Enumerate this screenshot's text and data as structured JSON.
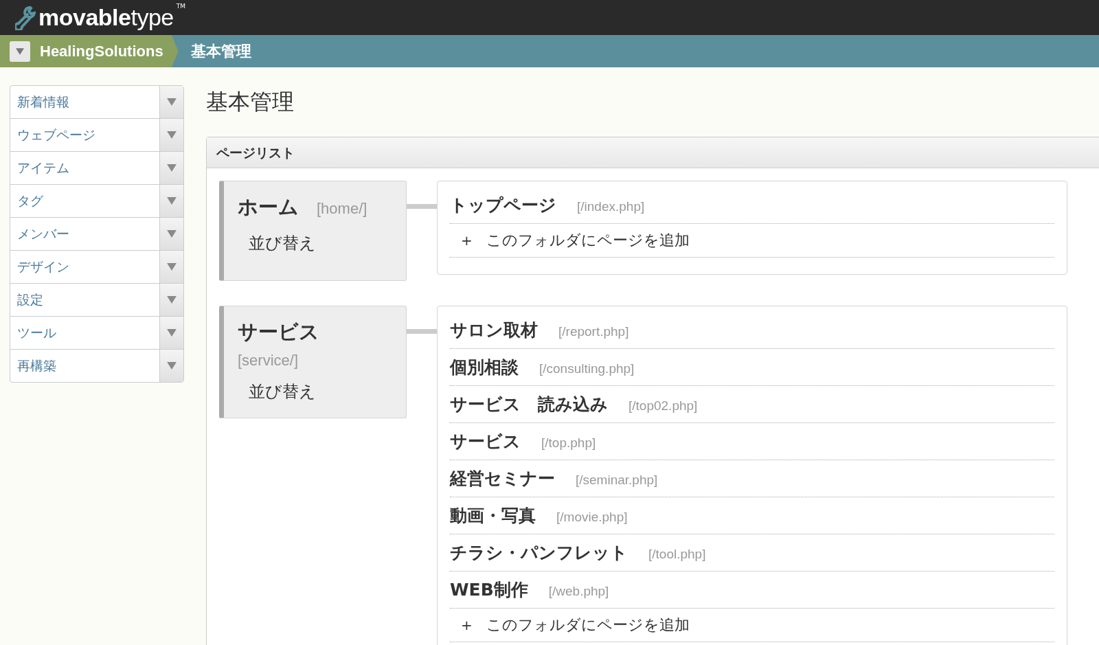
{
  "header": {
    "logo": "**movable**type",
    "trademark": "TM"
  },
  "breadcrumb": [
    {
      "label": "HealingSolutions",
      "kind": "site"
    },
    {
      "label": "基本管理",
      "kind": "current"
    }
  ],
  "sidebar": {
    "items": [
      {
        "label": "新着情報"
      },
      {
        "label": "ウェブページ"
      },
      {
        "label": "アイテム"
      },
      {
        "label": "タグ"
      },
      {
        "label": "メンバー"
      },
      {
        "label": "デザイン"
      },
      {
        "label": "設定"
      },
      {
        "label": "ツール"
      },
      {
        "label": "再構築"
      }
    ]
  },
  "page_title": "基本管理",
  "panel": {
    "title": "ページリスト",
    "folders": [
      {
        "name": "ホーム",
        "path": "[home/]",
        "path_inline": true,
        "sort": "並び替え",
        "pages": [
          {
            "title": "トップページ",
            "path": "[/index.php]"
          }
        ],
        "add_icon": "+",
        "add_label": "このフォルダにページを追加"
      },
      {
        "name": "サービス",
        "path": "[service/]",
        "path_inline": false,
        "sort": "並び替え",
        "pages": [
          {
            "title": "サロン取材",
            "path": "[/report.php]"
          },
          {
            "title": "個別相談",
            "path": "[/consulting.php]"
          },
          {
            "title": "サービス　読み込み",
            "path": "[/top02.php]"
          },
          {
            "title": "サービス",
            "path": "[/top.php]"
          },
          {
            "title": "経営セミナー",
            "path": "[/seminar.php]"
          },
          {
            "title": "動画・写真",
            "path": "[/movie.php]"
          },
          {
            "title": "チラシ・パンフレット",
            "path": "[/tool.php]"
          },
          {
            "title": "WEB制作",
            "path": "[/web.php]"
          }
        ],
        "add_icon": "+",
        "add_label": "このフォルダにページを追加"
      }
    ]
  }
}
